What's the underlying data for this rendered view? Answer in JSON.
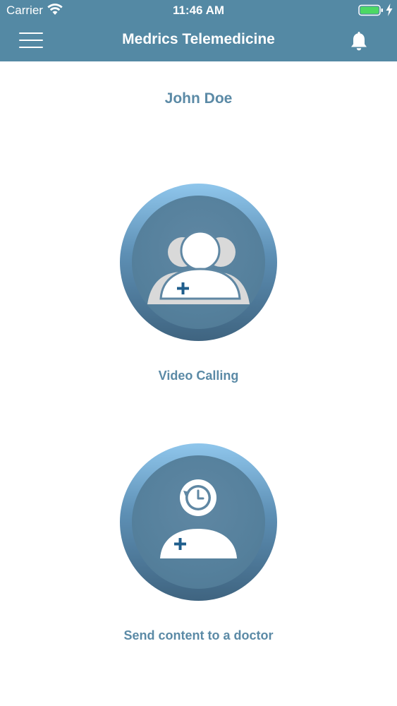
{
  "status_bar": {
    "carrier": "Carrier",
    "time": "11:46 AM"
  },
  "nav": {
    "title": "Medrics Telemedicine"
  },
  "user": {
    "name": "John Doe"
  },
  "actions": [
    {
      "label": "Video Calling",
      "icon": "video-call-group-icon"
    },
    {
      "label": "Send content to a doctor",
      "icon": "send-content-doctor-icon"
    }
  ],
  "colors": {
    "header": "#5489a4",
    "accent_text": "#5b8aa6",
    "battery": "#4cd964",
    "icon_plus": "#1f5e8c"
  }
}
